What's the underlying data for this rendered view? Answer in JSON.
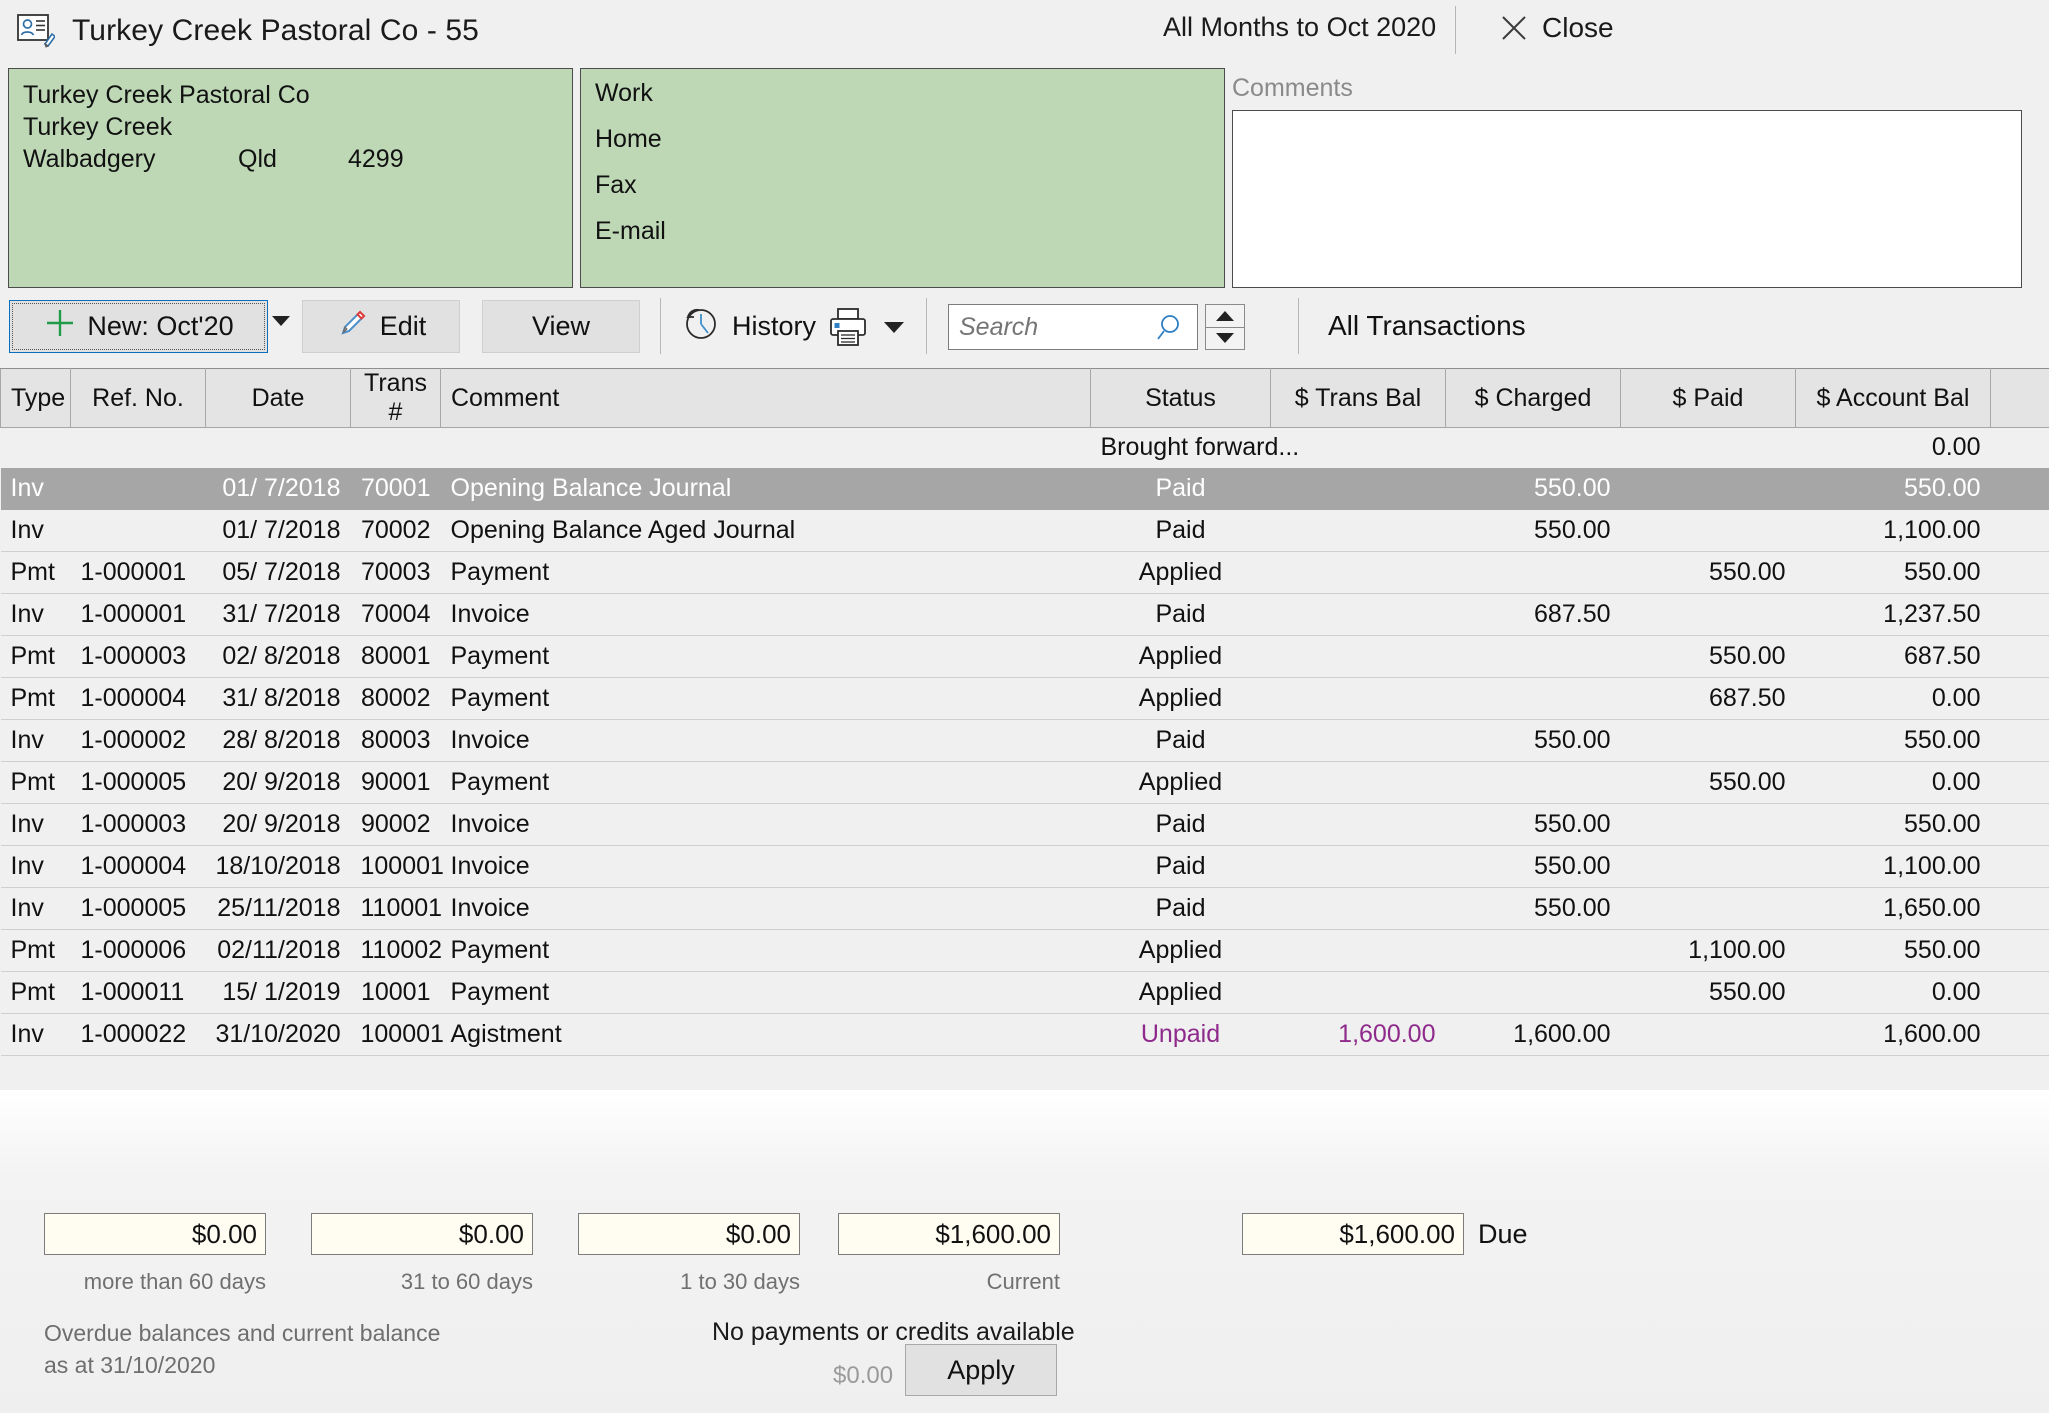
{
  "window": {
    "title": "Turkey Creek Pastoral Co - 55",
    "period": "All Months to Oct 2020",
    "close_label": "Close",
    "title_icon": "contact-card-edit-icon"
  },
  "address_panel": {
    "name": "Turkey Creek Pastoral Co",
    "street": "Turkey Creek",
    "city": "Walbadgery",
    "state": "Qld",
    "postcode": "4299"
  },
  "contact_panel": {
    "work_label": "Work",
    "home_label": "Home",
    "fax_label": "Fax",
    "email_label": "E-mail"
  },
  "comments": {
    "label": "Comments",
    "value": "",
    "placeholder": ""
  },
  "toolbar": {
    "new_label": "New: Oct'20",
    "edit_label": "Edit",
    "view_label": "View",
    "history_label": "History",
    "search_placeholder": "Search",
    "search_value": "",
    "filter_label": "All Transactions",
    "icons": {
      "new": "plus-icon",
      "new_dropdown": "chevron-down-icon",
      "edit": "pencil-icon",
      "history": "clock-back-icon",
      "print": "printer-icon",
      "print_dropdown": "chevron-down-icon",
      "search": "magnifier-icon",
      "spin_up": "triangle-up-icon",
      "spin_down": "triangle-down-icon"
    }
  },
  "table": {
    "columns": [
      "Type",
      "Ref. No.",
      "Date",
      "Trans #",
      "Comment",
      "Status",
      "$ Trans Bal",
      "$ Charged",
      "$ Paid",
      "$ Account Bal"
    ],
    "brought_forward_label": "Brought forward...",
    "brought_forward_balance": "0.00",
    "rows": [
      {
        "type": "Inv",
        "ref": "",
        "date": "01/ 7/2018",
        "trans": "70001",
        "comment": "Opening Balance Journal",
        "status": "Paid",
        "trans_bal": "",
        "charged": "550.00",
        "paid": "",
        "account_bal": "550.00",
        "selected": true,
        "unpaid": false
      },
      {
        "type": "Inv",
        "ref": "",
        "date": "01/ 7/2018",
        "trans": "70002",
        "comment": "Opening Balance Aged Journal",
        "status": "Paid",
        "trans_bal": "",
        "charged": "550.00",
        "paid": "",
        "account_bal": "1,100.00",
        "selected": false,
        "unpaid": false
      },
      {
        "type": "Pmt",
        "ref": "1-000001",
        "date": "05/ 7/2018",
        "trans": "70003",
        "comment": "Payment",
        "status": "Applied",
        "trans_bal": "",
        "charged": "",
        "paid": "550.00",
        "account_bal": "550.00",
        "selected": false,
        "unpaid": false
      },
      {
        "type": "Inv",
        "ref": "1-000001",
        "date": "31/ 7/2018",
        "trans": "70004",
        "comment": "Invoice",
        "status": "Paid",
        "trans_bal": "",
        "charged": "687.50",
        "paid": "",
        "account_bal": "1,237.50",
        "selected": false,
        "unpaid": false
      },
      {
        "type": "Pmt",
        "ref": "1-000003",
        "date": "02/ 8/2018",
        "trans": "80001",
        "comment": "Payment",
        "status": "Applied",
        "trans_bal": "",
        "charged": "",
        "paid": "550.00",
        "account_bal": "687.50",
        "selected": false,
        "unpaid": false
      },
      {
        "type": "Pmt",
        "ref": "1-000004",
        "date": "31/ 8/2018",
        "trans": "80002",
        "comment": "Payment",
        "status": "Applied",
        "trans_bal": "",
        "charged": "",
        "paid": "687.50",
        "account_bal": "0.00",
        "selected": false,
        "unpaid": false
      },
      {
        "type": "Inv",
        "ref": "1-000002",
        "date": "28/ 8/2018",
        "trans": "80003",
        "comment": "Invoice",
        "status": "Paid",
        "trans_bal": "",
        "charged": "550.00",
        "paid": "",
        "account_bal": "550.00",
        "selected": false,
        "unpaid": false
      },
      {
        "type": "Pmt",
        "ref": "1-000005",
        "date": "20/ 9/2018",
        "trans": "90001",
        "comment": "Payment",
        "status": "Applied",
        "trans_bal": "",
        "charged": "",
        "paid": "550.00",
        "account_bal": "0.00",
        "selected": false,
        "unpaid": false
      },
      {
        "type": "Inv",
        "ref": "1-000003",
        "date": "20/ 9/2018",
        "trans": "90002",
        "comment": "Invoice",
        "status": "Paid",
        "trans_bal": "",
        "charged": "550.00",
        "paid": "",
        "account_bal": "550.00",
        "selected": false,
        "unpaid": false
      },
      {
        "type": "Inv",
        "ref": "1-000004",
        "date": "18/10/2018",
        "trans": "100001",
        "comment": "Invoice",
        "status": "Paid",
        "trans_bal": "",
        "charged": "550.00",
        "paid": "",
        "account_bal": "1,100.00",
        "selected": false,
        "unpaid": false
      },
      {
        "type": "Inv",
        "ref": "1-000005",
        "date": "25/11/2018",
        "trans": "110001",
        "comment": "Invoice",
        "status": "Paid",
        "trans_bal": "",
        "charged": "550.00",
        "paid": "",
        "account_bal": "1,650.00",
        "selected": false,
        "unpaid": false
      },
      {
        "type": "Pmt",
        "ref": "1-000006",
        "date": "02/11/2018",
        "trans": "110002",
        "comment": "Payment",
        "status": "Applied",
        "trans_bal": "",
        "charged": "",
        "paid": "1,100.00",
        "account_bal": "550.00",
        "selected": false,
        "unpaid": false
      },
      {
        "type": "Pmt",
        "ref": "1-000011",
        "date": "15/ 1/2019",
        "trans": "10001",
        "comment": "Payment",
        "status": "Applied",
        "trans_bal": "",
        "charged": "",
        "paid": "550.00",
        "account_bal": "0.00",
        "selected": false,
        "unpaid": false
      },
      {
        "type": "Inv",
        "ref": "1-000022",
        "date": "31/10/2020",
        "trans": "100001",
        "comment": "Agistment",
        "status": "Unpaid",
        "trans_bal": "1,600.00",
        "charged": "1,600.00",
        "paid": "",
        "account_bal": "1,600.00",
        "selected": false,
        "unpaid": true
      }
    ]
  },
  "aging": {
    "buckets": [
      {
        "value": "$0.00",
        "label": "more than 60 days"
      },
      {
        "value": "$0.00",
        "label": "31 to 60 days"
      },
      {
        "value": "$0.00",
        "label": "1 to 30 days"
      },
      {
        "value": "$1,600.00",
        "label": "Current"
      }
    ],
    "due_value": "$1,600.00",
    "due_label": "Due",
    "note_line1": "Overdue balances and current balance",
    "note_line2": "as at 31/10/2020"
  },
  "apply_section": {
    "message": "No payments or credits available",
    "amount": "$0.00",
    "button_label": "Apply"
  },
  "colors": {
    "panel_green": "#bed8b6",
    "status_green": "#1a7a1a",
    "status_unpaid": "#8e2a8b",
    "selection_gray": "#a6a6a6",
    "money_field": "#fffdf2"
  }
}
